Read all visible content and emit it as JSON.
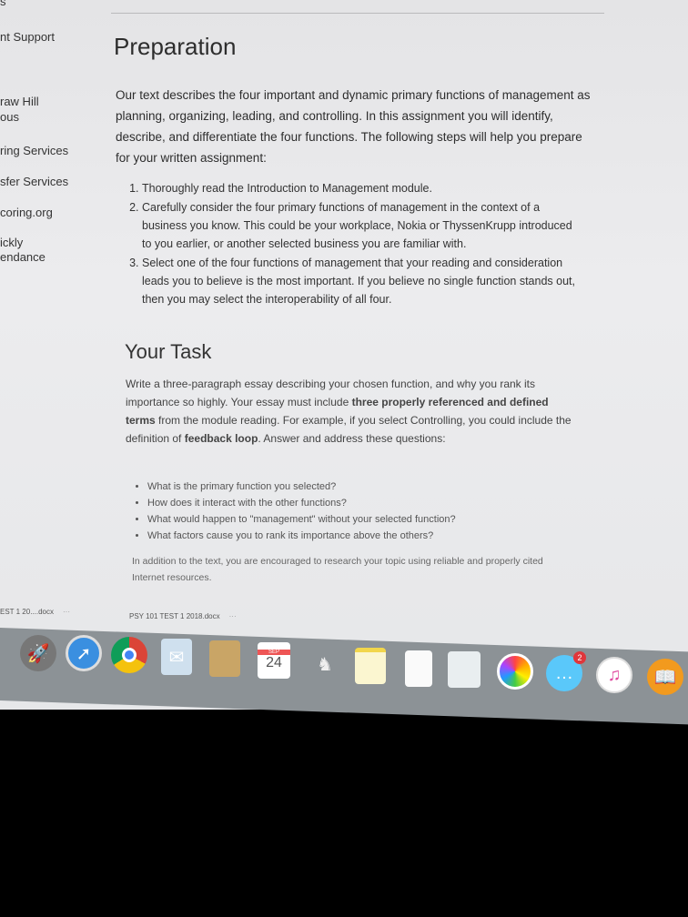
{
  "sidebar": {
    "items": [
      "s",
      "nt Support",
      "raw Hill",
      "ous",
      "ring Services",
      "sfer Services",
      "coring.org",
      "ickly",
      "endance"
    ]
  },
  "main": {
    "title": "Preparation",
    "intro": "Our text describes the four important and dynamic primary functions of management as planning, organizing, leading, and controlling. In this assignment you will identify, describe, and differentiate the four functions. The following steps will help you prepare for your written assignment:",
    "steps": [
      "Thoroughly read the Introduction to Management module.",
      "Carefully consider the four primary functions of management in the context of a business you know. This could be your workplace, Nokia or ThyssenKrupp introduced to you earlier, or another selected business you are familiar with.",
      "Select one of the four functions of management that your reading and consideration leads you to believe is the most important. If you believe no single function stands out, then you may select the interoperability of all four."
    ],
    "task_title": "Your Task",
    "task_p1": "Write a three-paragraph essay describing your chosen function, and why you rank its importance so highly. Your essay must include ",
    "task_b1": "three properly referenced and defined terms",
    "task_p2": " from the module reading. For example, if you select Controlling, you could include the definition of ",
    "task_b2": "feedback loop",
    "task_p3": ". Answer and address these questions:",
    "questions": [
      "What is the primary function you selected?",
      "How does it interact with the other functions?",
      "What would happen to \"management\" without your selected function?",
      "What factors cause you to rank its importance above the others?"
    ],
    "footer_note": "In addition to the text, you are encouraged to research your topic using reliable and properly cited Internet resources."
  },
  "downloads": [
    {
      "name": "EST 1 20....docx",
      "more": "···"
    },
    {
      "name": "PSY 101 TEST 1 2018.docx",
      "more": "···"
    }
  ],
  "dock": {
    "calendar_month": "SEP",
    "calendar_day": "24",
    "messages_badge": "2"
  }
}
